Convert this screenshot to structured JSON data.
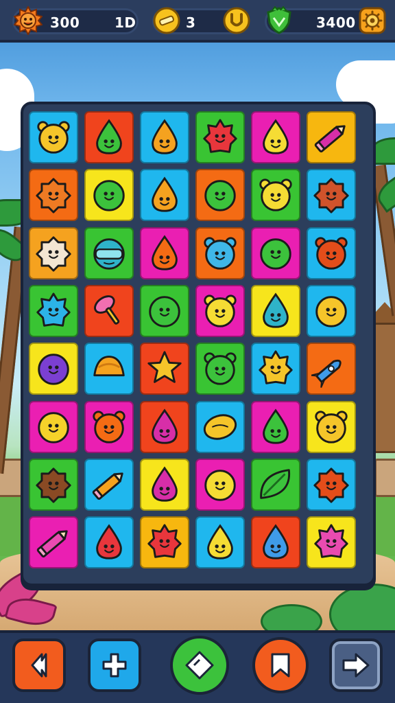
{
  "hud": {
    "lives": {
      "icon": "sun-face-icon",
      "value": "300"
    },
    "moves": {
      "value": "1D"
    },
    "coins": {
      "icon": "coin-icon",
      "value": "3"
    },
    "coin_badge": {
      "icon": "coin-u-icon"
    },
    "gems": {
      "icon": "green-shield-icon",
      "value": "3400"
    },
    "settings": {
      "icon": "gear-icon"
    }
  },
  "board": {
    "columns": 6,
    "rows": 8,
    "tiles": [
      [
        {
          "bg": "#1fb7ee",
          "c": "#f5c52a",
          "shape": "bear"
        },
        {
          "bg": "#f0441d",
          "c": "#3cc23c",
          "shape": "drop"
        },
        {
          "bg": "#1fb7ee",
          "c": "#f5a21f",
          "shape": "drop"
        },
        {
          "bg": "#39c433",
          "c": "#e8363c",
          "shape": "spiky"
        },
        {
          "bg": "#ea1fb2",
          "c": "#f5dc34",
          "shape": "drop"
        },
        {
          "bg": "#f7b70f",
          "c": "#d72ea8",
          "shape": "pencil"
        }
      ],
      [
        {
          "bg": "#f46b14",
          "c": "#ee7a23",
          "shape": "fuzzy"
        },
        {
          "bg": "#f7e51c",
          "c": "#3cc23c",
          "shape": "round"
        },
        {
          "bg": "#1fb7ee",
          "c": "#f5a21f",
          "shape": "drop"
        },
        {
          "bg": "#f46b14",
          "c": "#3cc23c",
          "shape": "round"
        },
        {
          "bg": "#39c433",
          "c": "#f5dc34",
          "shape": "bear"
        },
        {
          "bg": "#1fb7ee",
          "c": "#d0532b",
          "shape": "fuzzy"
        }
      ],
      [
        {
          "bg": "#f5a21f",
          "c": "#f3e6d2",
          "shape": "fuzzy"
        },
        {
          "bg": "#39c433",
          "c": "#2fb3c9",
          "shape": "mask"
        },
        {
          "bg": "#ea1fb2",
          "c": "#f46b14",
          "shape": "drop"
        },
        {
          "bg": "#f46b14",
          "c": "#3fb7e8",
          "shape": "bear"
        },
        {
          "bg": "#ea1fb2",
          "c": "#3cc23c",
          "shape": "round"
        },
        {
          "bg": "#1fb7ee",
          "c": "#e44d1a",
          "shape": "bear"
        }
      ],
      [
        {
          "bg": "#39c433",
          "c": "#2cb3e8",
          "shape": "spiky"
        },
        {
          "bg": "#f0441d",
          "c": "#f06fb0",
          "shape": "pin"
        },
        {
          "bg": "#39c433",
          "c": "#3cc23c",
          "shape": "round"
        },
        {
          "bg": "#ea1fb2",
          "c": "#f5dc34",
          "shape": "bear"
        },
        {
          "bg": "#f7e51c",
          "c": "#2fb3c9",
          "shape": "drop"
        },
        {
          "bg": "#1fb7ee",
          "c": "#f5c52a",
          "shape": "round"
        }
      ],
      [
        {
          "bg": "#f7e51c",
          "c": "#7b3fd2",
          "shape": "round"
        },
        {
          "bg": "#1fb7ee",
          "c": "#f5a21f",
          "shape": "taco"
        },
        {
          "bg": "#f0441d",
          "c": "#f5c52a",
          "shape": "star"
        },
        {
          "bg": "#39c433",
          "c": "#3cc23c",
          "shape": "bear"
        },
        {
          "bg": "#1fb7ee",
          "c": "#f5c52a",
          "shape": "spiky"
        },
        {
          "bg": "#f46b14",
          "c": "#3f9be8",
          "shape": "rocket"
        }
      ],
      [
        {
          "bg": "#ea1fb2",
          "c": "#f5d22a",
          "shape": "round"
        },
        {
          "bg": "#ea1fb2",
          "c": "#f46b14",
          "shape": "bear"
        },
        {
          "bg": "#f0441d",
          "c": "#d72ea8",
          "shape": "drop"
        },
        {
          "bg": "#1fb7ee",
          "c": "#f5c52a",
          "shape": "lemon"
        },
        {
          "bg": "#ea1fb2",
          "c": "#3cc23c",
          "shape": "drop"
        },
        {
          "bg": "#f7e51c",
          "c": "#f5c52a",
          "shape": "bear"
        }
      ],
      [
        {
          "bg": "#39c433",
          "c": "#8a4a24",
          "shape": "fuzzy"
        },
        {
          "bg": "#1fb7ee",
          "c": "#f5a21f",
          "shape": "pencil"
        },
        {
          "bg": "#f7e51c",
          "c": "#d72ea8",
          "shape": "drop"
        },
        {
          "bg": "#ea1fb2",
          "c": "#f5dc34",
          "shape": "round"
        },
        {
          "bg": "#39c433",
          "c": "#3cc23c",
          "shape": "leaf"
        },
        {
          "bg": "#1fb7ee",
          "c": "#e44d1a",
          "shape": "fuzzy"
        }
      ],
      [
        {
          "bg": "#ea1fb2",
          "c": "#e94bb0",
          "shape": "pencil"
        },
        {
          "bg": "#1fb7ee",
          "c": "#e8363c",
          "shape": "drop"
        },
        {
          "bg": "#f7b70f",
          "c": "#e8363c",
          "shape": "spiky"
        },
        {
          "bg": "#1fb7ee",
          "c": "#f5dc34",
          "shape": "drop"
        },
        {
          "bg": "#f0441d",
          "c": "#3f9be8",
          "shape": "drop"
        },
        {
          "bg": "#f7e51c",
          "c": "#e94bb0",
          "shape": "spiky"
        }
      ]
    ]
  },
  "bottom_bar": {
    "buttons": [
      {
        "name": "back-button",
        "icon": "back-icon",
        "color": "#f25c1e"
      },
      {
        "name": "add-button",
        "icon": "plus-icon",
        "color": "#1fa8ea"
      },
      {
        "name": "play-button",
        "icon": "diamond-icon",
        "color": "#3cc23c"
      },
      {
        "name": "bookmark-button",
        "icon": "bookmark-icon",
        "color": "#f25c1e"
      },
      {
        "name": "next-button",
        "icon": "arrow-right-icon",
        "color": "#4a5f84"
      }
    ]
  },
  "colors": {
    "hud_bg": "#2b3d5e",
    "board_bg": "#2c3e5c",
    "outline": "#18233a"
  }
}
